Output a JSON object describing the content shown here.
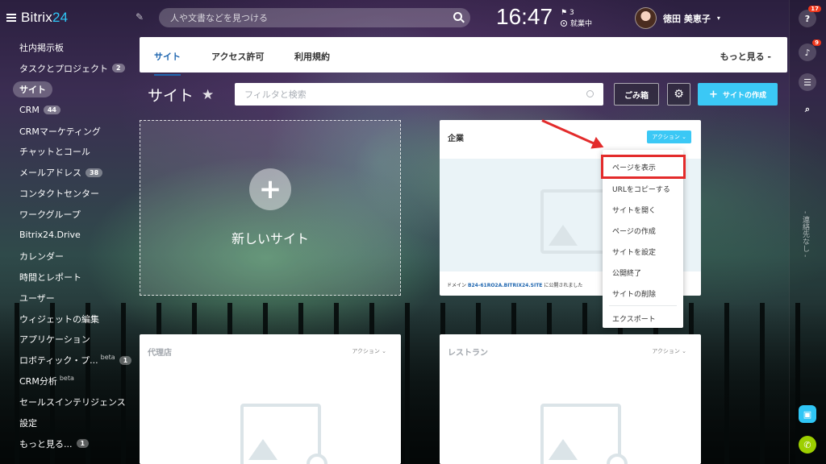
{
  "header": {
    "brand_main": "Bitrix",
    "brand_accent": "24",
    "search_placeholder": "人や文書などを見つける",
    "clock": "16:47",
    "flag_count": "3",
    "work_status": "就業中",
    "user_name": "徳田 美恵子"
  },
  "sidebar": {
    "items": [
      {
        "label": "社内掲示板"
      },
      {
        "label": "タスクとプロジェクト",
        "count": "2"
      },
      {
        "label": "サイト",
        "active": true
      },
      {
        "label": "CRM",
        "count": "44"
      },
      {
        "label": "CRMマーケティング"
      },
      {
        "label": "チャットとコール"
      },
      {
        "label": "メールアドレス",
        "count": "38"
      },
      {
        "label": "コンタクトセンター"
      },
      {
        "label": "ワークグループ"
      },
      {
        "label": "Bitrix24.Drive"
      },
      {
        "label": "カレンダー"
      },
      {
        "label": "時間とレポート"
      },
      {
        "label": "ユーザー"
      },
      {
        "label": "ウィジェットの編集"
      },
      {
        "label": "アプリケーション"
      },
      {
        "label": "ロボティック・プ...",
        "sup": "beta",
        "count": "1"
      },
      {
        "label": "CRM分析",
        "sup": "beta"
      },
      {
        "label": "セールスインテリジェンス"
      },
      {
        "label": "設定"
      },
      {
        "label": "もっと見る...",
        "count": "1"
      }
    ]
  },
  "tabs": {
    "items": [
      "サイト",
      "アクセス許可",
      "利用規約"
    ],
    "more": "もっと見る"
  },
  "page": {
    "title": "サイト",
    "filter_placeholder": "フィルタと検索",
    "trash_label": "ごみ箱",
    "create_label": "サイトの作成",
    "new_site_label": "新しいサイト"
  },
  "cards": [
    {
      "title": "企業",
      "action": "アクション",
      "domain_prefix": "ドメイン",
      "domain": "B24-61RO2A.BITRIX24.SITE",
      "domain_suffix": "に公開されました"
    },
    {
      "title": "代理店",
      "action": "アクション"
    },
    {
      "title": "レストラン",
      "action": "アクション"
    }
  ],
  "action_menu": {
    "items": [
      "ページを表示",
      "URLをコピーする",
      "サイトを開く",
      "ページの作成",
      "サイトを設定",
      "公開終了",
      "サイトの削除",
      "エクスポート"
    ]
  },
  "rightbar": {
    "help_badge": "17",
    "notif_badge": "9",
    "no_contacts": "- 連絡先なし -"
  },
  "colors": {
    "accent": "#3bc8f5",
    "active_tab": "#2067b0",
    "highlight": "#e32b2b"
  }
}
